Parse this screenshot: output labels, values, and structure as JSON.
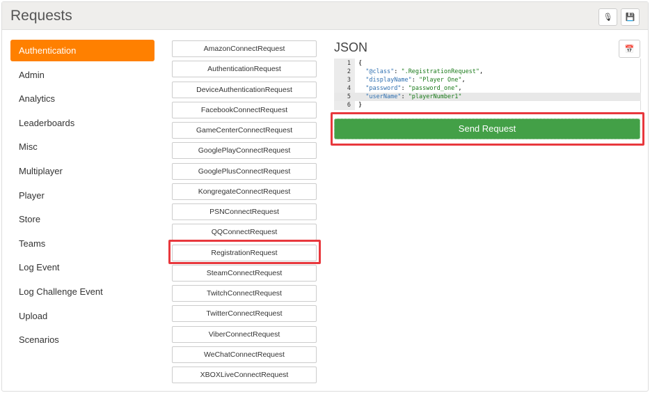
{
  "header": {
    "title": "Requests",
    "mic_icon": "microphone-icon",
    "save_icon": "floppy-disk-icon"
  },
  "sidebar": {
    "items": [
      {
        "label": "Authentication",
        "active": true
      },
      {
        "label": "Admin"
      },
      {
        "label": "Analytics"
      },
      {
        "label": "Leaderboards"
      },
      {
        "label": "Misc"
      },
      {
        "label": "Multiplayer"
      },
      {
        "label": "Player"
      },
      {
        "label": "Store"
      },
      {
        "label": "Teams"
      },
      {
        "label": "Log Event"
      },
      {
        "label": "Log Challenge Event"
      },
      {
        "label": "Upload"
      },
      {
        "label": "Scenarios"
      }
    ]
  },
  "requests": {
    "selected": "RegistrationRequest",
    "items": [
      "AmazonConnectRequest",
      "AuthenticationRequest",
      "DeviceAuthenticationRequest",
      "FacebookConnectRequest",
      "GameCenterConnectRequest",
      "GooglePlayConnectRequest",
      "GooglePlusConnectRequest",
      "KongregateConnectRequest",
      "PSNConnectRequest",
      "QQConnectRequest",
      "RegistrationRequest",
      "SteamConnectRequest",
      "TwitchConnectRequest",
      "TwitterConnectRequest",
      "ViberConnectRequest",
      "WeChatConnectRequest",
      "XBOXLiveConnectRequest"
    ]
  },
  "json": {
    "title": "JSON",
    "lines": [
      {
        "n": "1",
        "open": "{"
      },
      {
        "n": "2",
        "key": "\"@class\"",
        "val": "\".RegistrationRequest\"",
        "comma": ","
      },
      {
        "n": "3",
        "key": "\"displayName\"",
        "val": "\"Player One\"",
        "comma": ","
      },
      {
        "n": "4",
        "key": "\"password\"",
        "val": "\"password_one\"",
        "comma": ","
      },
      {
        "n": "5",
        "key": "\"userName\"",
        "val": "\"playerNumber1\"",
        "comma": ""
      },
      {
        "n": "6",
        "open": "}"
      }
    ]
  },
  "send_label": "Send Request",
  "colors": {
    "accent": "#ff8000",
    "send": "#43a047",
    "highlight": "#e8383d"
  }
}
